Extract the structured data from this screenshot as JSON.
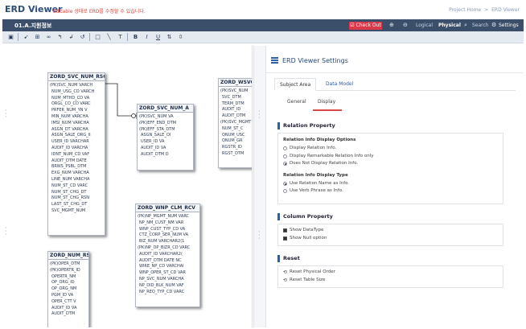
{
  "app": {
    "title": "ERD Viewer",
    "note": "Editable 상태로 ERD를 수정할 수 있습니다.",
    "breadcrumb": [
      "Project Home",
      ">",
      "ERD Viewer"
    ]
  },
  "titlebar": {
    "doc_title": "01.A.지원정보",
    "checkout": "Check Out",
    "views": [
      "Logical",
      "Physical"
    ],
    "active_view": "Physical",
    "search": "Search",
    "settings": "Settings"
  },
  "entities": [
    {
      "name": "ZORD_SVC_NUM_RSC",
      "rows": [
        "(PK)SVC_NUM  VARCH",
        "NUM_USG_CD  VARCH",
        "NUM_MTHD_CD  VA",
        "ORGL_CO_CD  VARC",
        "PRFER_NUM_YN  V",
        "MIN_NUM  VARCHA",
        "IMSI_NUM  VARCHA",
        "ASGN_DT  VARCHA",
        "ASGN_SALE_ORG_II",
        "USER_ID  VARCHAR",
        "AUDIT_ID  VARCHA",
        "IDNT_NUM_CD  VAF",
        "AUDIT_DTM  DATE",
        "BRWS_PSBL_DTM",
        "EXG_NUM  VARCHA",
        "LINE_NUM  VARCHA",
        "NUM_ST_CD  VARC",
        "NUM_ST_CHG_DT",
        "NUM_ST_CHG_RSN",
        "LAST_ST_CHG_DT",
        "SVC_MGMT_NUM"
      ]
    },
    {
      "name": "ZORD_SVC_NUM_A",
      "rows": [
        "(PK)SVC_NUM  VA",
        "(PK)EFF_END_DTM",
        "(PK)EFF_STA_DTM",
        "ASGN_SALE_OI",
        "USER_ID  VA",
        "AUDIT_ID  VA",
        "AUDIT_DTM  D"
      ]
    },
    {
      "name": "ZORD_WSVC_Q",
      "rows": [
        "(PK)SVC_NUM",
        "SVC_DTM",
        "TERM_DTM",
        "AUDIT_ID",
        "AUDIT_DTM",
        "(PK)SVC_MGMT",
        "NUM_ST_C",
        "QNUM_USC",
        "QNUM_GR",
        "RGSTR_ID",
        "RGST_DTM"
      ]
    },
    {
      "name": "ZORD_WNP_CLM_RCV",
      "rows": [
        "(PK)NP_MGMT_NUM  VARC",
        "NP_NM_CUST_NM  VAR",
        "WNP_CUST_TYP_CD  VA",
        "CTZ_CORP_SER_NUM  VA",
        "BIZ_NUM  VARCHAR2(1",
        "(PK)NP_OP_BIZR_CD  VARC",
        "AUDIT_ID  VARCHAR2(",
        "AUDIT_DTM  DATE  NC",
        "WIRE_NP_CD  VARCHAI",
        "WNP_OPER_ST_CD  VAR",
        "NP_SVC_NUM  VARCHA",
        "NP_DID_BLK_NUM  VAF",
        "NP_REQ_TYP_CD  VARC"
      ]
    },
    {
      "name": "ZORD_NUM_RSC",
      "rows": [
        "(PK)OPER_DTM",
        "(PK)OPERTR_ID",
        "OPERTR_NM",
        "OP_ORG_ID",
        "OP_ORG_NM",
        "PGM_ID  VA",
        "OPER_CTT  V",
        "AUDIT_ID  VA",
        "AUDIT_DTM"
      ]
    }
  ],
  "panel": {
    "title": "ERD Viewer Settings",
    "tabs": [
      "Subject Area",
      "Data Model"
    ],
    "active_tab": "Subject Area",
    "subtabs": [
      "General",
      "Display"
    ],
    "active_subtab": "Display",
    "relation": {
      "heading": "Relation Property",
      "display_title": "Relation Info Display Options",
      "display_options": [
        "Display Relation Info.",
        "Display Remarkable Relation Info only",
        "Does Not Display Relation Info."
      ],
      "display_selected": 2,
      "type_title": "Relation Info Display Type",
      "type_options": [
        "Use Relation Name as Info.",
        "Use Verb Phrase as Info."
      ],
      "type_selected": 0
    },
    "column": {
      "heading": "Column Property",
      "options": [
        "Show DataType",
        "Show Null option"
      ]
    },
    "reset": {
      "heading": "Reset",
      "actions": [
        "Reset Physical Order",
        "Reset Table Size"
      ]
    }
  },
  "colors": {
    "titlebar": "#3b4f6b",
    "checkout": "#d9394a",
    "accent": "#2b5fa8",
    "app_title": "#2d4d7a",
    "note": "#e0453a"
  }
}
